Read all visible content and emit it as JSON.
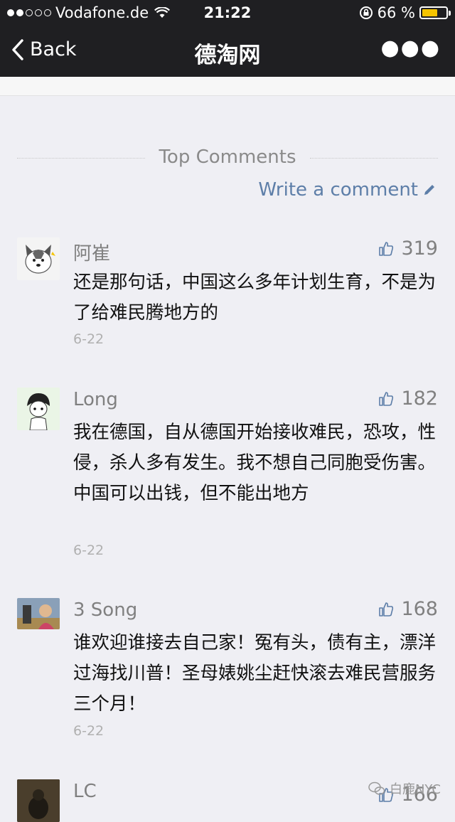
{
  "status": {
    "carrier": "Vodafone.de",
    "time": "21:22",
    "battery": "66 %",
    "battery_level": 0.66
  },
  "nav": {
    "back": "Back",
    "title": "德淘网"
  },
  "section_title": "Top Comments",
  "write_comment": "Write a comment",
  "comments": [
    {
      "name": "阿崔",
      "likes": "319",
      "text": "还是那句话，中国这么多年计划生育，不是为了给难民腾地方的",
      "date": "6-22"
    },
    {
      "name": "Long",
      "likes": "182",
      "text": "我在德国，自从德国开始接收难民，恐攻，性侵，杀人多有发生。我不想自己同胞受伤害。中国可以出钱，但不能出地方",
      "date": "6-22"
    },
    {
      "name": "3 Song",
      "likes": "168",
      "text": "谁欢迎谁接去自己家！冤有头，债有主，漂洋过海找川普！圣母婊姚尘赶快滚去难民营服务三个月！",
      "date": "6-22"
    },
    {
      "name": "LC",
      "likes": "166"
    }
  ],
  "watermark": "白鹿NYC"
}
